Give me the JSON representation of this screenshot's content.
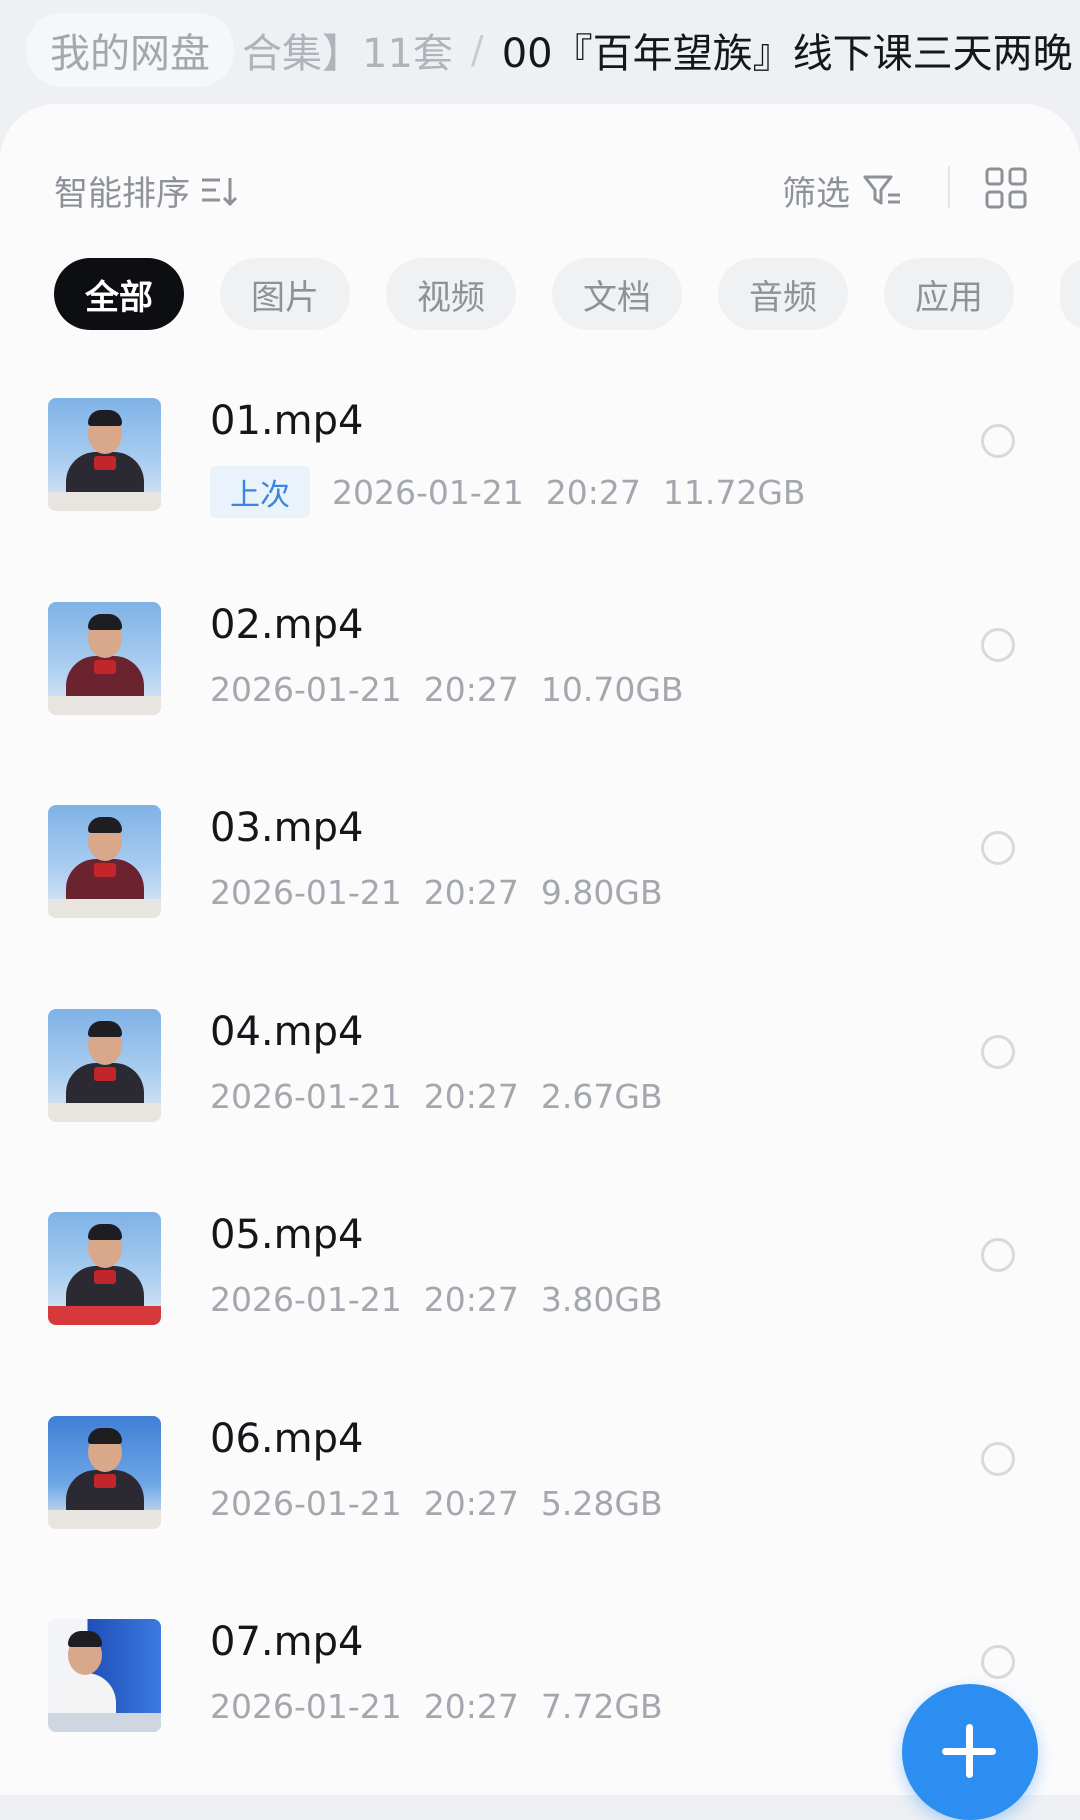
{
  "breadcrumb": {
    "root": "我的网盘",
    "middle": "合集】11套",
    "separator": "/",
    "current": "00『百年望族』线下课三天两晚"
  },
  "toolbar": {
    "sort_label": "智能排序",
    "filter_label": "筛选"
  },
  "categories": [
    "全部",
    "图片",
    "视频",
    "文档",
    "音频",
    "应用"
  ],
  "active_category": "全部",
  "files": [
    {
      "name": "01.mp4",
      "tag": "上次",
      "date": "2026-01-21",
      "time": "20:27",
      "size": "11.72GB"
    },
    {
      "name": "02.mp4",
      "tag": "",
      "date": "2026-01-21",
      "time": "20:27",
      "size": "10.70GB"
    },
    {
      "name": "03.mp4",
      "tag": "",
      "date": "2026-01-21",
      "time": "20:27",
      "size": "9.80GB"
    },
    {
      "name": "04.mp4",
      "tag": "",
      "date": "2026-01-21",
      "time": "20:27",
      "size": "2.67GB"
    },
    {
      "name": "05.mp4",
      "tag": "",
      "date": "2026-01-21",
      "time": "20:27",
      "size": "3.80GB"
    },
    {
      "name": "06.mp4",
      "tag": "",
      "date": "2026-01-21",
      "time": "20:27",
      "size": "5.28GB"
    },
    {
      "name": "07.mp4",
      "tag": "",
      "date": "2026-01-21",
      "time": "20:27",
      "size": "7.72GB"
    }
  ],
  "icons": {
    "sort": "sort-icon",
    "filter": "filter-icon",
    "grid": "grid-view-icon",
    "fab": "plus-icon"
  },
  "colors": {
    "accent": "#2b8ef0",
    "active_chip": "#0d0e12",
    "tag_text": "#3a86dd"
  }
}
